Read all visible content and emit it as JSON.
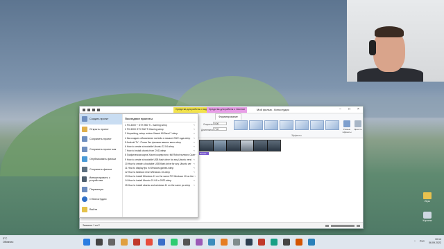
{
  "window": {
    "title": "Мой фильм - Киностудия",
    "context_tab_video": "Средства для работы с видео",
    "context_tab_text": "Средства для работы с текстом",
    "format_tab": "Форматирование",
    "file_tab": "Файл",
    "status": "Элемент 1 из 2"
  },
  "ribbon": {
    "label_speed": "Скорость",
    "label_duration": "Длительность",
    "value_speed": "0:00",
    "value_duration": "7,00",
    "effects_label": "Эффекты",
    "btn_multiple": "Разные эффекты",
    "btn_brightness": "Яркость"
  },
  "timeline": {
    "caption": "Фильм"
  },
  "file_menu": {
    "items": [
      {
        "label": "Создать проект",
        "icon": "new-project-icon"
      },
      {
        "label": "Открыть проект",
        "icon": "open-project-icon"
      },
      {
        "label": "Сохранить проект",
        "icon": "save-project-icon"
      },
      {
        "label": "Сохранить проект как",
        "icon": "save-as-icon"
      },
      {
        "label": "Опубликовать фильм",
        "icon": "publish-icon"
      },
      {
        "label": "Сохранить фильм",
        "icon": "save-movie-icon"
      },
      {
        "label": "Импортировать с устройства",
        "icon": "import-icon"
      },
      {
        "label": "Параметры",
        "icon": "options-icon"
      },
      {
        "label": "О Киностудии",
        "icon": "about-icon"
      },
      {
        "label": "Выйти",
        "icon": "exit-icon"
      }
    ],
    "recent_header": "Последние проекты",
    "recent": [
      "1 FX-3300 + GTX 960 Ti - Gaming.wlmp",
      "2 FX-3300 GTX 960 Ti Gaming.wlmp",
      "3 Unpacking, setup review Xiaomi Mi Band 7.wlmp",
      "4 Как создать объявление на Avito в начале 2022 года.wlmp",
      "5 Android TV - Поиск без фильма вашего кино.wlmp",
      "6 How to create a bootable Ubuntu 22.04.wlmp",
      "7 How to Install ubuntu from DVD.wlmp",
      "8 Графическая карта Xiaomi корпусного: full Robot полного Скан",
      "9 How to create a bootable USB flash drive for any Ubuntu versi",
      "10 How to create a bootable USB flash drive for any Ubuntu ver",
      "11 How to display fps in Windows games.wlmp",
      "12 How to fastboot reset Windows 10.wlmp",
      "13 How to install Windows 11 on the same PC Windows 10 on the",
      "14 How to install Ubuntu 21.04 in 2022.wlmp",
      "15 How to install ubuntu and windows 11 on the same pc.wlmp"
    ]
  },
  "taskbar": {
    "weather_temp": "3°C",
    "weather_desc": "Облачно",
    "time": "10:14",
    "date": "06.09.2022",
    "lang": "РУС"
  },
  "desktop": {
    "icon1_label": "Игры",
    "icon2_label": "Корзина"
  }
}
